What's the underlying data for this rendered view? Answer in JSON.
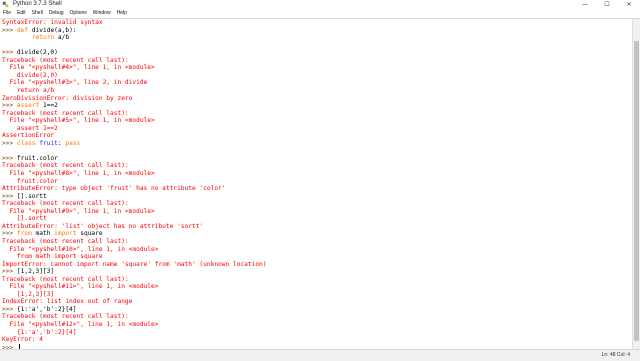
{
  "window": {
    "title": "Python 3.7.3 Shell",
    "minimize_glyph": "—",
    "maximize_glyph": "☐",
    "close_glyph": "✕"
  },
  "menu": [
    "File",
    "Edit",
    "Shell",
    "Debug",
    "Options",
    "Window",
    "Help"
  ],
  "status": {
    "position": "Ln: 48  Col: 4"
  },
  "colors": {
    "prompt": "#7a3f00",
    "error": "#ff0000",
    "output": "#1f1fff",
    "keyword": "#ff7700",
    "builtin": "#900090",
    "string": "#008000"
  },
  "shell_lines": [
    [
      [
        "SyntaxError: invalid syntax",
        "error"
      ]
    ],
    [
      [
        ">>> ",
        "prompt"
      ],
      [
        "def",
        "keyword"
      ],
      [
        " divide(a,b):",
        "plain"
      ]
    ],
    [
      [
        "        ",
        "plain"
      ],
      [
        "return",
        "keyword"
      ],
      [
        " a/b",
        "plain"
      ]
    ],
    [
      [
        "",
        "plain"
      ]
    ],
    [
      [
        ">>> ",
        "prompt"
      ],
      [
        "divide(2,0)",
        "plain"
      ]
    ],
    [
      [
        "Traceback (most recent call last):",
        "error"
      ]
    ],
    [
      [
        "  File \"<pyshell#4>\", line 1, in <module>",
        "error"
      ]
    ],
    [
      [
        "    divide(2,0)",
        "error"
      ]
    ],
    [
      [
        "  File \"<pyshell#3>\", line 2, in divide",
        "error"
      ]
    ],
    [
      [
        "    return a/b",
        "error"
      ]
    ],
    [
      [
        "ZeroDivisionError: division by zero",
        "error"
      ]
    ],
    [
      [
        ">>> ",
        "prompt"
      ],
      [
        "assert",
        "keyword"
      ],
      [
        " 1==2",
        "plain"
      ]
    ],
    [
      [
        "Traceback (most recent call last):",
        "error"
      ]
    ],
    [
      [
        "  File \"<pyshell#5>\", line 1, in <module>",
        "error"
      ]
    ],
    [
      [
        "    assert 1==2",
        "error"
      ]
    ],
    [
      [
        "AssertionError",
        "error"
      ]
    ],
    [
      [
        ">>> ",
        "prompt"
      ],
      [
        "class",
        "keyword"
      ],
      [
        " ",
        "plain"
      ],
      [
        "fruit",
        "output"
      ],
      [
        ": ",
        "plain"
      ],
      [
        "pass",
        "keyword"
      ]
    ],
    [
      [
        "",
        "plain"
      ]
    ],
    [
      [
        ">>> ",
        "prompt"
      ],
      [
        "fruit.color",
        "plain"
      ]
    ],
    [
      [
        "Traceback (most recent call last):",
        "error"
      ]
    ],
    [
      [
        "  File \"<pyshell#8>\", line 1, in <module>",
        "error"
      ]
    ],
    [
      [
        "    fruit.color",
        "error"
      ]
    ],
    [
      [
        "AttributeError: type object 'fruit' has no attribute 'color'",
        "error"
      ]
    ],
    [
      [
        ">>> ",
        "prompt"
      ],
      [
        "[].sortt",
        "plain"
      ]
    ],
    [
      [
        "Traceback (most recent call last):",
        "error"
      ]
    ],
    [
      [
        "  File \"<pyshell#9>\", line 1, in <module>",
        "error"
      ]
    ],
    [
      [
        "    [].sortt",
        "error"
      ]
    ],
    [
      [
        "AttributeError: 'list' object has no attribute 'sortt'",
        "error"
      ]
    ],
    [
      [
        ">>> ",
        "prompt"
      ],
      [
        "from",
        "keyword"
      ],
      [
        " math ",
        "plain"
      ],
      [
        "import",
        "keyword"
      ],
      [
        " square",
        "plain"
      ]
    ],
    [
      [
        "Traceback (most recent call last):",
        "error"
      ]
    ],
    [
      [
        "  File \"<pyshell#10>\", line 1, in <module>",
        "error"
      ]
    ],
    [
      [
        "    from math import square",
        "error"
      ]
    ],
    [
      [
        "ImportError: cannot import name 'square' from 'math' (unknown location)",
        "error"
      ]
    ],
    [
      [
        ">>> ",
        "prompt"
      ],
      [
        "[1,2,3][3]",
        "plain"
      ]
    ],
    [
      [
        "Traceback (most recent call last):",
        "error"
      ]
    ],
    [
      [
        "  File \"<pyshell#11>\", line 1, in <module>",
        "error"
      ]
    ],
    [
      [
        "    [1,2,3][3]",
        "error"
      ]
    ],
    [
      [
        "IndexError: list index out of range",
        "error"
      ]
    ],
    [
      [
        ">>> ",
        "prompt"
      ],
      [
        "{1:'a','b':2}[4]",
        "plain"
      ]
    ],
    [
      [
        "Traceback (most recent call last):",
        "error"
      ]
    ],
    [
      [
        "  File \"<pyshell#12>\", line 1, in <module>",
        "error"
      ]
    ],
    [
      [
        "    {1:'a','b':2}[4]",
        "error"
      ]
    ],
    [
      [
        "KeyError: 4",
        "error"
      ]
    ],
    [
      [
        ">>> ",
        "prompt"
      ]
    ]
  ]
}
